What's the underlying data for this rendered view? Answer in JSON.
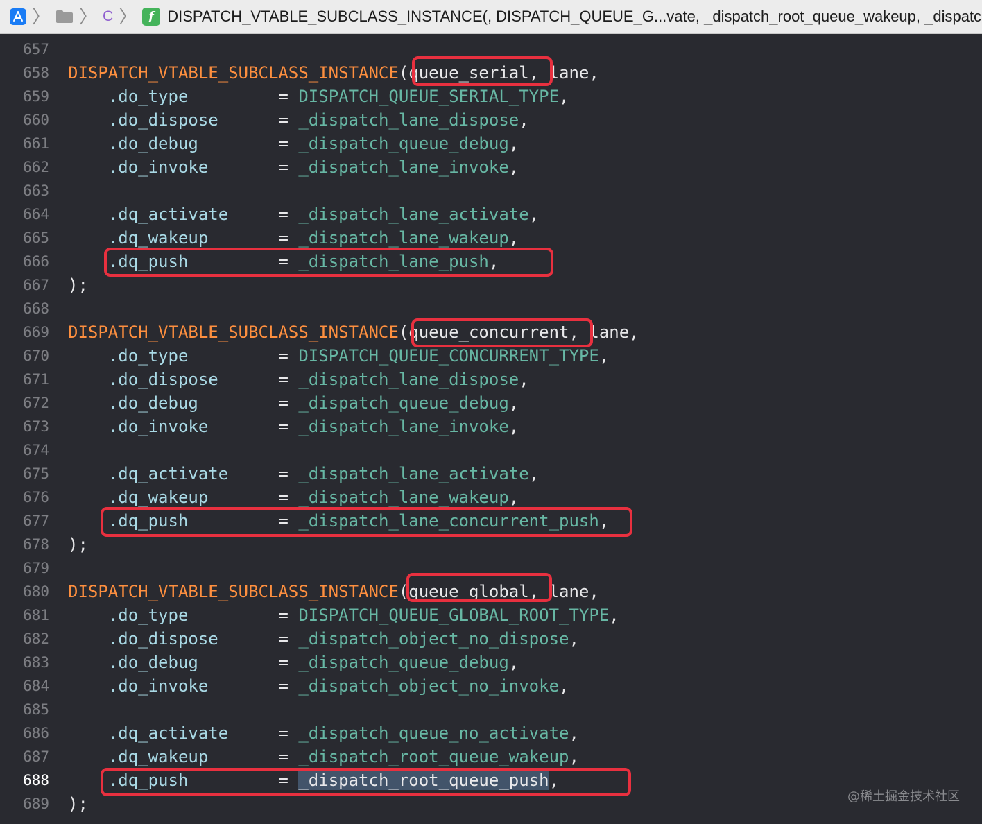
{
  "jump_bar": {
    "app_icon": "xcode-project-icon",
    "folder_icon": "folder-icon",
    "file_type_letter": "C",
    "function_icon_glyph": "f",
    "title": "DISPATCH_VTABLE_SUBCLASS_INSTANCE(, DISPATCH_QUEUE_G...vate, _dispatch_root_queue_wakeup, _dispatc"
  },
  "editor": {
    "current_line": 688,
    "lines": [
      {
        "num": "657",
        "tokens": []
      },
      {
        "num": "658",
        "tokens": [
          {
            "c": "macro",
            "t": "DISPATCH_VTABLE_SUBCLASS_INSTANCE"
          },
          {
            "c": "plain",
            "t": "(queue_serial, lane,"
          }
        ]
      },
      {
        "num": "659",
        "tokens": [
          {
            "c": "plain",
            "t": "    "
          },
          {
            "c": "prop",
            "t": ".do_type"
          },
          {
            "c": "plain",
            "t": "         = "
          },
          {
            "c": "const",
            "t": "DISPATCH_QUEUE_SERIAL_TYPE"
          },
          {
            "c": "plain",
            "t": ","
          }
        ]
      },
      {
        "num": "660",
        "tokens": [
          {
            "c": "plain",
            "t": "    "
          },
          {
            "c": "prop",
            "t": ".do_dispose"
          },
          {
            "c": "plain",
            "t": "      = "
          },
          {
            "c": "fn",
            "t": "_dispatch_lane_dispose"
          },
          {
            "c": "plain",
            "t": ","
          }
        ]
      },
      {
        "num": "661",
        "tokens": [
          {
            "c": "plain",
            "t": "    "
          },
          {
            "c": "prop",
            "t": ".do_debug"
          },
          {
            "c": "plain",
            "t": "        = "
          },
          {
            "c": "fn",
            "t": "_dispatch_queue_debug"
          },
          {
            "c": "plain",
            "t": ","
          }
        ]
      },
      {
        "num": "662",
        "tokens": [
          {
            "c": "plain",
            "t": "    "
          },
          {
            "c": "prop",
            "t": ".do_invoke"
          },
          {
            "c": "plain",
            "t": "       = "
          },
          {
            "c": "fn",
            "t": "_dispatch_lane_invoke"
          },
          {
            "c": "plain",
            "t": ","
          }
        ]
      },
      {
        "num": "663",
        "tokens": []
      },
      {
        "num": "664",
        "tokens": [
          {
            "c": "plain",
            "t": "    "
          },
          {
            "c": "prop",
            "t": ".dq_activate"
          },
          {
            "c": "plain",
            "t": "     = "
          },
          {
            "c": "fn",
            "t": "_dispatch_lane_activate"
          },
          {
            "c": "plain",
            "t": ","
          }
        ]
      },
      {
        "num": "665",
        "tokens": [
          {
            "c": "plain",
            "t": "    "
          },
          {
            "c": "prop",
            "t": ".dq_wakeup"
          },
          {
            "c": "plain",
            "t": "       = "
          },
          {
            "c": "fn",
            "t": "_dispatch_lane_wakeup"
          },
          {
            "c": "plain",
            "t": ","
          }
        ]
      },
      {
        "num": "666",
        "tokens": [
          {
            "c": "plain",
            "t": "    "
          },
          {
            "c": "prop",
            "t": ".dq_push"
          },
          {
            "c": "plain",
            "t": "         = "
          },
          {
            "c": "fn",
            "t": "_dispatch_lane_push"
          },
          {
            "c": "plain",
            "t": ","
          }
        ]
      },
      {
        "num": "667",
        "tokens": [
          {
            "c": "plain",
            "t": ");"
          }
        ]
      },
      {
        "num": "668",
        "tokens": []
      },
      {
        "num": "669",
        "tokens": [
          {
            "c": "macro",
            "t": "DISPATCH_VTABLE_SUBCLASS_INSTANCE"
          },
          {
            "c": "plain",
            "t": "(queue_concurrent, lane,"
          }
        ]
      },
      {
        "num": "670",
        "tokens": [
          {
            "c": "plain",
            "t": "    "
          },
          {
            "c": "prop",
            "t": ".do_type"
          },
          {
            "c": "plain",
            "t": "         = "
          },
          {
            "c": "const",
            "t": "DISPATCH_QUEUE_CONCURRENT_TYPE"
          },
          {
            "c": "plain",
            "t": ","
          }
        ]
      },
      {
        "num": "671",
        "tokens": [
          {
            "c": "plain",
            "t": "    "
          },
          {
            "c": "prop",
            "t": ".do_dispose"
          },
          {
            "c": "plain",
            "t": "      = "
          },
          {
            "c": "fn",
            "t": "_dispatch_lane_dispose"
          },
          {
            "c": "plain",
            "t": ","
          }
        ]
      },
      {
        "num": "672",
        "tokens": [
          {
            "c": "plain",
            "t": "    "
          },
          {
            "c": "prop",
            "t": ".do_debug"
          },
          {
            "c": "plain",
            "t": "        = "
          },
          {
            "c": "fn",
            "t": "_dispatch_queue_debug"
          },
          {
            "c": "plain",
            "t": ","
          }
        ]
      },
      {
        "num": "673",
        "tokens": [
          {
            "c": "plain",
            "t": "    "
          },
          {
            "c": "prop",
            "t": ".do_invoke"
          },
          {
            "c": "plain",
            "t": "       = "
          },
          {
            "c": "fn",
            "t": "_dispatch_lane_invoke"
          },
          {
            "c": "plain",
            "t": ","
          }
        ]
      },
      {
        "num": "674",
        "tokens": []
      },
      {
        "num": "675",
        "tokens": [
          {
            "c": "plain",
            "t": "    "
          },
          {
            "c": "prop",
            "t": ".dq_activate"
          },
          {
            "c": "plain",
            "t": "     = "
          },
          {
            "c": "fn",
            "t": "_dispatch_lane_activate"
          },
          {
            "c": "plain",
            "t": ","
          }
        ]
      },
      {
        "num": "676",
        "tokens": [
          {
            "c": "plain",
            "t": "    "
          },
          {
            "c": "prop",
            "t": ".dq_wakeup"
          },
          {
            "c": "plain",
            "t": "       = "
          },
          {
            "c": "fn",
            "t": "_dispatch_lane_wakeup"
          },
          {
            "c": "plain",
            "t": ","
          }
        ]
      },
      {
        "num": "677",
        "tokens": [
          {
            "c": "plain",
            "t": "    "
          },
          {
            "c": "prop",
            "t": ".dq_push"
          },
          {
            "c": "plain",
            "t": "         = "
          },
          {
            "c": "fn",
            "t": "_dispatch_lane_concurrent_push"
          },
          {
            "c": "plain",
            "t": ","
          }
        ]
      },
      {
        "num": "678",
        "tokens": [
          {
            "c": "plain",
            "t": ");"
          }
        ]
      },
      {
        "num": "679",
        "tokens": []
      },
      {
        "num": "680",
        "tokens": [
          {
            "c": "macro",
            "t": "DISPATCH_VTABLE_SUBCLASS_INSTANCE"
          },
          {
            "c": "plain",
            "t": "(queue_global, lane,"
          }
        ]
      },
      {
        "num": "681",
        "tokens": [
          {
            "c": "plain",
            "t": "    "
          },
          {
            "c": "prop",
            "t": ".do_type"
          },
          {
            "c": "plain",
            "t": "         = "
          },
          {
            "c": "const",
            "t": "DISPATCH_QUEUE_GLOBAL_ROOT_TYPE"
          },
          {
            "c": "plain",
            "t": ","
          }
        ]
      },
      {
        "num": "682",
        "tokens": [
          {
            "c": "plain",
            "t": "    "
          },
          {
            "c": "prop",
            "t": ".do_dispose"
          },
          {
            "c": "plain",
            "t": "      = "
          },
          {
            "c": "fn",
            "t": "_dispatch_object_no_dispose"
          },
          {
            "c": "plain",
            "t": ","
          }
        ]
      },
      {
        "num": "683",
        "tokens": [
          {
            "c": "plain",
            "t": "    "
          },
          {
            "c": "prop",
            "t": ".do_debug"
          },
          {
            "c": "plain",
            "t": "        = "
          },
          {
            "c": "fn",
            "t": "_dispatch_queue_debug"
          },
          {
            "c": "plain",
            "t": ","
          }
        ]
      },
      {
        "num": "684",
        "tokens": [
          {
            "c": "plain",
            "t": "    "
          },
          {
            "c": "prop",
            "t": ".do_invoke"
          },
          {
            "c": "plain",
            "t": "       = "
          },
          {
            "c": "fn",
            "t": "_dispatch_object_no_invoke"
          },
          {
            "c": "plain",
            "t": ","
          }
        ]
      },
      {
        "num": "685",
        "tokens": []
      },
      {
        "num": "686",
        "tokens": [
          {
            "c": "plain",
            "t": "    "
          },
          {
            "c": "prop",
            "t": ".dq_activate"
          },
          {
            "c": "plain",
            "t": "     = "
          },
          {
            "c": "fn",
            "t": "_dispatch_queue_no_activate"
          },
          {
            "c": "plain",
            "t": ","
          }
        ]
      },
      {
        "num": "687",
        "tokens": [
          {
            "c": "plain",
            "t": "    "
          },
          {
            "c": "prop",
            "t": ".dq_wakeup"
          },
          {
            "c": "plain",
            "t": "       = "
          },
          {
            "c": "fn",
            "t": "_dispatch_root_queue_wakeup"
          },
          {
            "c": "plain",
            "t": ","
          }
        ]
      },
      {
        "num": "688",
        "tokens": [
          {
            "c": "plain",
            "t": "    "
          },
          {
            "c": "prop",
            "t": ".dq_push"
          },
          {
            "c": "plain",
            "t": "         = "
          },
          {
            "c": "sel",
            "t": "_dispatch_root_queue_push"
          },
          {
            "c": "plain",
            "t": ","
          }
        ]
      },
      {
        "num": "689",
        "tokens": [
          {
            "c": "plain",
            "t": ");"
          }
        ]
      }
    ]
  },
  "annotation_color": "#e8303f",
  "watermark": "@稀土掘金技术社区"
}
